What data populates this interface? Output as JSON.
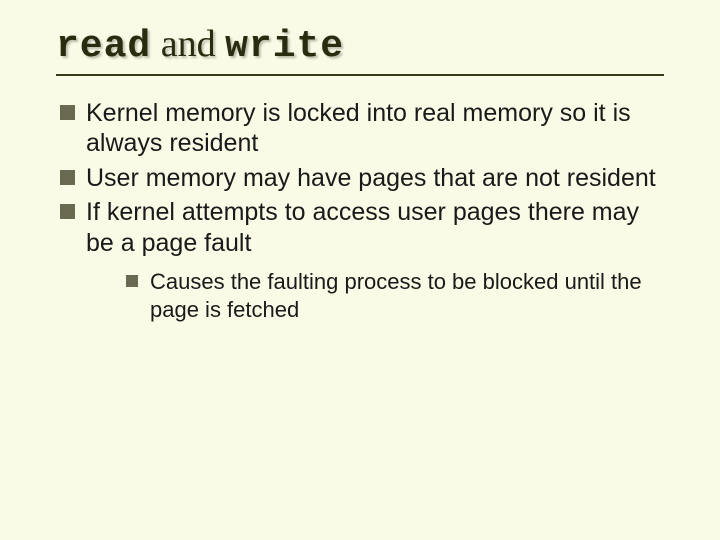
{
  "title": {
    "code1": "read",
    "and": " and ",
    "code2": "write"
  },
  "bullets": [
    "Kernel memory is locked into real memory so it is always resident",
    "User memory may have pages that are not resident",
    "If kernel attempts to access user pages there may be a page fault"
  ],
  "sub_bullets": [
    "Causes the faulting process to be blocked until the page is fetched"
  ]
}
